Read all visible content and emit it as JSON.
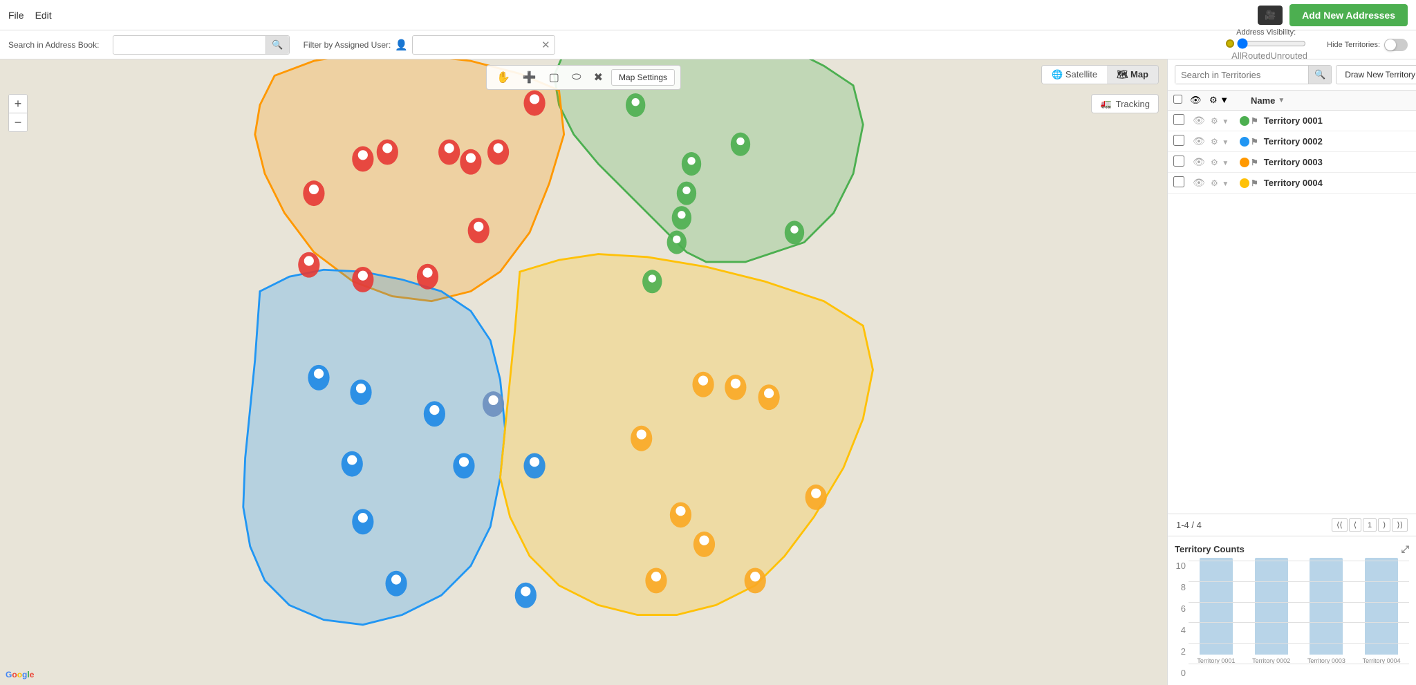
{
  "topbar": {
    "file_label": "File",
    "edit_label": "Edit",
    "add_btn_label": "Add New Addresses"
  },
  "searchbar": {
    "address_book_label": "Search in Address Book:",
    "address_placeholder": "",
    "filter_label": "Filter by Assigned User:",
    "filter_placeholder": "",
    "address_visibility_label": "Address Visibility:",
    "hide_territories_label": "Hide Territories:",
    "slider_all": "All",
    "slider_routed": "Routed",
    "slider_unrouted": "Unrouted"
  },
  "map": {
    "satellite_label": "Satellite",
    "map_label": "Map",
    "tracking_label": "Tracking",
    "map_settings_label": "Map Settings",
    "zoom_in": "+",
    "zoom_out": "−",
    "google_label": "Google"
  },
  "right_panel": {
    "search_placeholder": "Search in Territories",
    "draw_btn_label": "Draw New Territory",
    "name_col_label": "Name",
    "territories": [
      {
        "id": "t0001",
        "name": "Territory 0001",
        "color": "#4caf50"
      },
      {
        "id": "t0002",
        "name": "Territory 0002",
        "color": "#2196f3"
      },
      {
        "id": "t0003",
        "name": "Territory 0003",
        "color": "#ff9800"
      },
      {
        "id": "t0004",
        "name": "Territory 0004",
        "color": "#ffc107"
      }
    ],
    "pagination_label": "1-4 / 4"
  },
  "territory_counts": {
    "title": "Territory Counts",
    "y_axis": [
      "10",
      "8",
      "6",
      "4",
      "2",
      "0"
    ],
    "bars": [
      {
        "label": "Territory 0001",
        "height_pct": 0
      },
      {
        "label": "Territory 0002",
        "height_pct": 0
      },
      {
        "label": "Territory 0003",
        "height_pct": 0
      },
      {
        "label": "Territory 0004",
        "height_pct": 0
      }
    ]
  },
  "icons": {
    "search": "🔍",
    "user": "👤",
    "close": "✕",
    "eye": "👁",
    "gear": "⚙",
    "chevron_down": "▼",
    "flag": "⚑",
    "satellite": "🌐",
    "map": "🗺",
    "truck": "🚛",
    "video": "🎥",
    "expand": "⤢",
    "nav_first": "⟨⟨",
    "nav_prev": "⟨",
    "nav_page": "1",
    "nav_next": "⟩",
    "nav_last": "⟩⟩"
  }
}
